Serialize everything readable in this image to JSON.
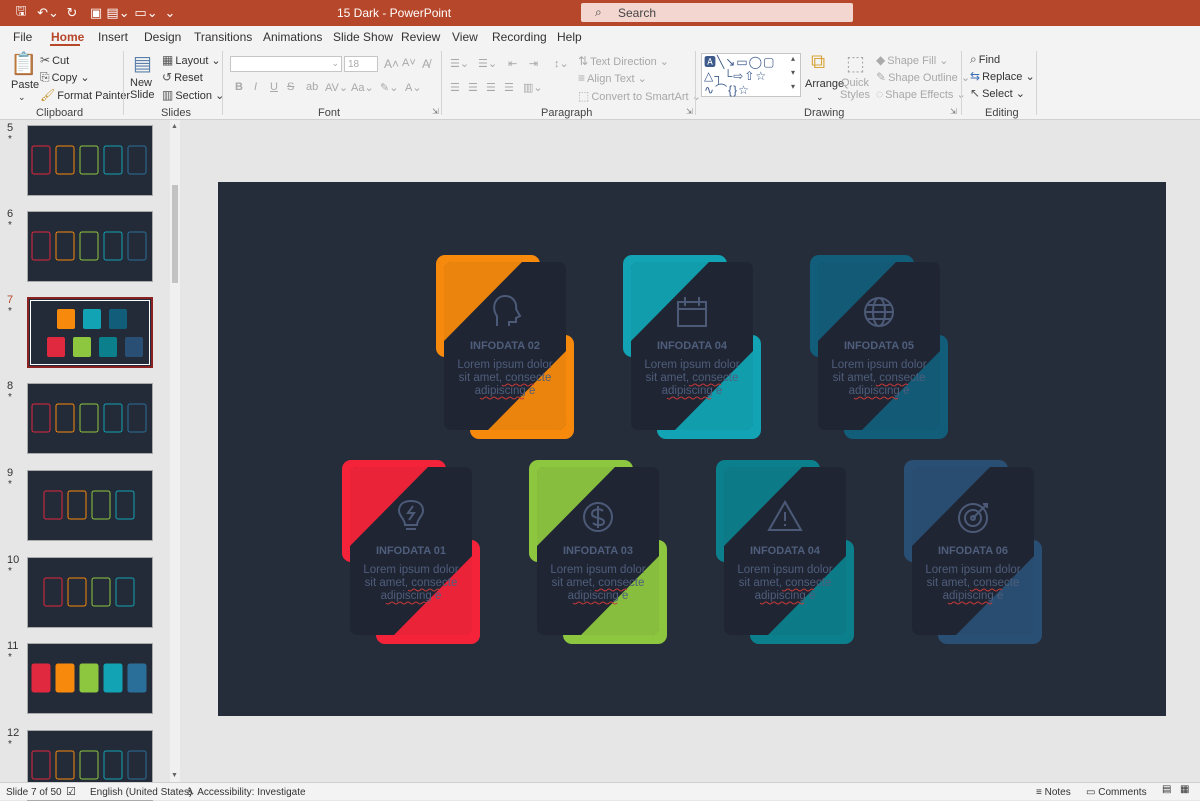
{
  "window": {
    "title": "15 Dark  -  PowerPoint",
    "search_placeholder": "Search"
  },
  "ribbon_tabs": [
    "File",
    "Home",
    "Insert",
    "Design",
    "Transitions",
    "Animations",
    "Slide Show",
    "Review",
    "View",
    "Recording",
    "Help"
  ],
  "active_tab": "Home",
  "ribbon": {
    "clipboard": {
      "paste": "Paste",
      "cut": "Cut",
      "copy": "Copy",
      "format_painter": "Format Painter",
      "label": "Clipboard"
    },
    "slides": {
      "new_slide": "New Slide",
      "layout": "Layout",
      "reset": "Reset",
      "section": "Section",
      "label": "Slides"
    },
    "font": {
      "font_size": "18",
      "label": "Font"
    },
    "paragraph": {
      "text_direction": "Text Direction",
      "align_text": "Align Text",
      "convert_smartart": "Convert to SmartArt",
      "label": "Paragraph"
    },
    "drawing": {
      "arrange": "Arrange",
      "quick_styles": "Quick Styles",
      "shape_fill": "Shape Fill",
      "shape_outline": "Shape Outline",
      "shape_effects": "Shape Effects",
      "label": "Drawing"
    },
    "editing": {
      "find": "Find",
      "replace": "Replace",
      "select": "Select",
      "label": "Editing"
    }
  },
  "thumbnails": [
    {
      "num": "5",
      "star": "*"
    },
    {
      "num": "6",
      "star": "*"
    },
    {
      "num": "7",
      "star": "*",
      "active": true
    },
    {
      "num": "8",
      "star": "*"
    },
    {
      "num": "9",
      "star": "*"
    },
    {
      "num": "10",
      "star": "*"
    },
    {
      "num": "11",
      "star": "*"
    },
    {
      "num": "12",
      "star": "*"
    }
  ],
  "slide": {
    "background": "#252c3a",
    "cards": [
      {
        "title": "INFODATA 02",
        "icon": "head-icon",
        "color": "#f7890c",
        "text": [
          "Lorem ipsum dolor",
          "sit amet, consecte",
          "adipiscing e"
        ]
      },
      {
        "title": "INFODATA 04",
        "icon": "calendar-icon",
        "color": "#12a3b4",
        "text": [
          "Lorem ipsum dolor",
          "sit amet, consecte",
          "adipiscing e"
        ]
      },
      {
        "title": "INFODATA 05",
        "icon": "globe-icon",
        "color": "#125d7a",
        "text": [
          "Lorem ipsum dolor",
          "sit amet, consecte",
          "adipiscing e"
        ]
      },
      {
        "title": "INFODATA 01",
        "icon": "lightbulb-icon",
        "color": "#f5233a",
        "text": [
          "Lorem ipsum dolor",
          "sit amet, consecte",
          "adipiscing e"
        ]
      },
      {
        "title": "INFODATA 03",
        "icon": "dollar-icon",
        "color": "#8dc63f",
        "text": [
          "Lorem ipsum dolor",
          "sit amet, consecte",
          "adipiscing e"
        ]
      },
      {
        "title": "INFODATA 04",
        "icon": "warning-icon",
        "color": "#0c7f8c",
        "text": [
          "Lorem ipsum dolor",
          "sit amet, consecte",
          "adipiscing e"
        ]
      },
      {
        "title": "INFODATA 06",
        "icon": "target-icon",
        "color": "#2a4f74",
        "text": [
          "Lorem ipsum dolor",
          "sit amet, consecte",
          "adipiscing e"
        ]
      }
    ]
  },
  "status": {
    "slide_info": "Slide 7 of 50",
    "language": "English (United States)",
    "accessibility": "Accessibility: Investigate",
    "notes": "Notes",
    "comments": "Comments"
  }
}
